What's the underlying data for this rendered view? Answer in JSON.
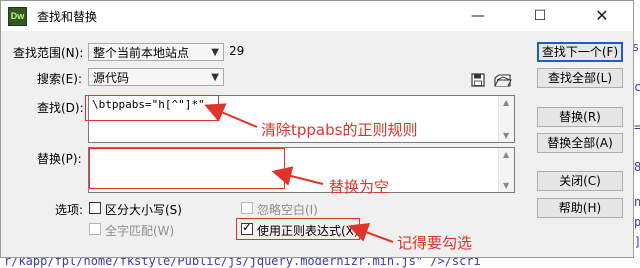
{
  "background_code": {
    "bottom_line": "r/kapp/fpl/home/fkstyle/Public/js/jquery.modernizr.min.js\" />/scri",
    "right_snippets": [
      "se",
      "c",
      "=",
      "8",
      "n",
      "p",
      "]"
    ]
  },
  "titlebar": {
    "app_icon_text": "Dw",
    "title": "查找和替换",
    "minimize_icon": "—",
    "maximize_icon": "☐",
    "close_icon": "✕"
  },
  "scope": {
    "label": "查找范围(N):",
    "value": "整个当前本地站点",
    "count": "29"
  },
  "search_type": {
    "label": "搜索(E):",
    "value": "源代码"
  },
  "find": {
    "label": "查找(D):",
    "value": "\\btppabs=\"h[^\"]*\""
  },
  "replace": {
    "label": "替换(P):",
    "value": ""
  },
  "options": {
    "label": "选项:",
    "match_case": {
      "label": "区分大小写(S)",
      "checked": false
    },
    "ignore_whitespace": {
      "label": "忽略空白(I)",
      "checked": false,
      "disabled": true
    },
    "whole_word": {
      "label": "全字匹配(W)",
      "checked": false,
      "disabled": true
    },
    "use_regex": {
      "label": "使用正则表达式(X)",
      "checked": true
    }
  },
  "buttons": {
    "find_next": "查找下一个(F)",
    "find_all": "查找全部(L)",
    "replace": "替换(R)",
    "replace_all": "替换全部(A)",
    "close": "关闭(C)",
    "help": "帮助(H)"
  },
  "icons": {
    "save": "save-icon",
    "open": "open-icon"
  },
  "annotations": {
    "find_note": "清除tppabs的正则规则",
    "replace_note": "替换为空",
    "regex_note": "记得要勾选"
  },
  "colors": {
    "annotation": "#e0342b",
    "default_button_border": "#1e5fbf",
    "code_text": "#3a3aa8"
  }
}
